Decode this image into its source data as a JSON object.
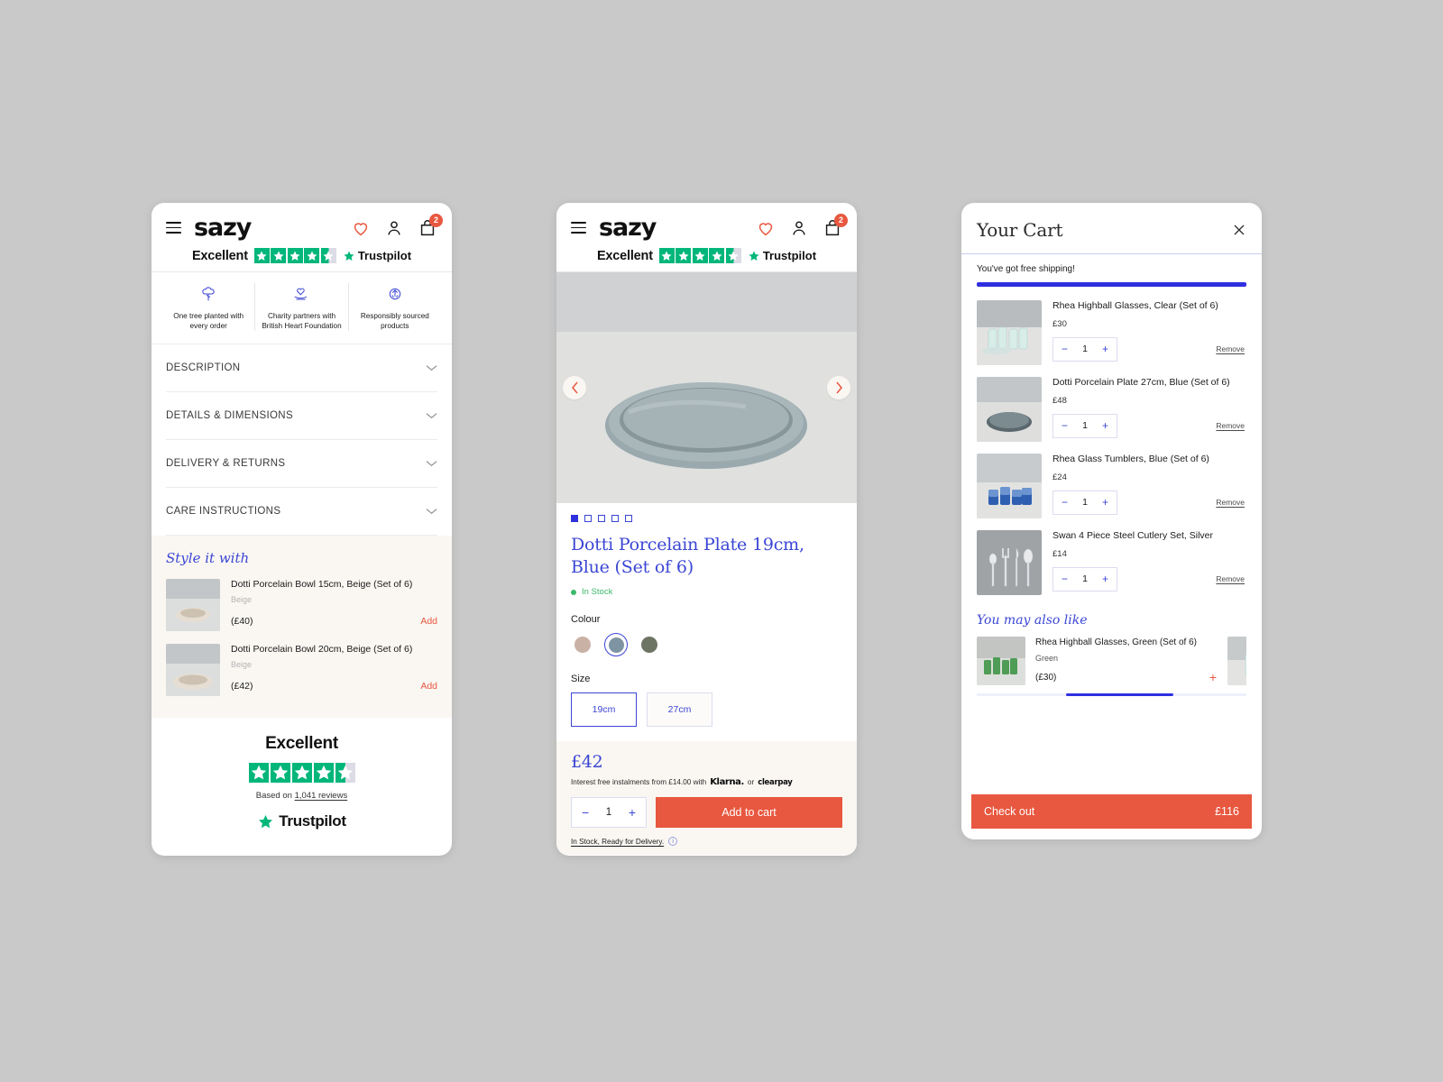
{
  "brand": "sazy",
  "header": {
    "menu_icon": "hamburger-icon",
    "wishlist_icon": "heart-icon",
    "account_icon": "user-icon",
    "cart_icon": "bag-icon",
    "cart_count": "2"
  },
  "trustpilot": {
    "rating_word": "Excellent",
    "name": "Trustpilot",
    "stars_full": 4,
    "stars_half": true,
    "footer_title": "Excellent",
    "based_on_prefix": "Based on ",
    "review_count": "1,041 reviews"
  },
  "usps": [
    {
      "icon": "tree-icon",
      "text": "One tree planted with every order"
    },
    {
      "icon": "heart-hand-icon",
      "text": "Charity partners with British Heart Foundation"
    },
    {
      "icon": "globe-recycle-icon",
      "text": "Responsibly sourced products"
    }
  ],
  "accordions": [
    {
      "label": "DESCRIPTION"
    },
    {
      "label": "DETAILS & DIMENSIONS"
    },
    {
      "label": "DELIVERY & RETURNS"
    },
    {
      "label": "CARE INSTRUCTIONS"
    }
  ],
  "style_it_with": {
    "title": "Style it with",
    "items": [
      {
        "name": "Dotti Porcelain Bowl 15cm, Beige (Set of 6)",
        "variant": "Beige",
        "price": "(£40)",
        "add_label": "Add"
      },
      {
        "name": "Dotti Porcelain Bowl 20cm, Beige (Set of 6)",
        "variant": "Beige",
        "price": "(£42)",
        "add_label": "Add"
      }
    ]
  },
  "pdp": {
    "prev_label": "‹",
    "next_label": "›",
    "dots": 5,
    "active_dot": 0,
    "title": "Dotti Porcelain Plate 19cm, Blue (Set of 6)",
    "stock_label": "In Stock",
    "colour_label": "Colour",
    "colours": [
      {
        "name": "beige",
        "hex": "#c9b2a5",
        "selected": false
      },
      {
        "name": "blue",
        "hex": "#7e94a3",
        "selected": true
      },
      {
        "name": "green",
        "hex": "#6e7463",
        "selected": false
      }
    ],
    "size_label": "Size",
    "sizes": [
      {
        "label": "19cm",
        "selected": true
      },
      {
        "label": "27cm",
        "selected": false
      }
    ],
    "price": "£42",
    "finance_text": "Interest free instalments from £14.00 with",
    "klarna_label": "Klarna.",
    "finance_or": "or",
    "clearpay_label": "clearpay",
    "qty_minus": "−",
    "qty_value": "1",
    "qty_plus": "+",
    "add_to_cart_label": "Add to cart",
    "delivery_note": "In Stock, Ready for Delivery.",
    "info_icon": "info-icon"
  },
  "cart": {
    "title": "Your Cart",
    "close_icon": "close-icon",
    "shipping_message": "You've got free shipping!",
    "shipping_progress": 100,
    "items": [
      {
        "name": "Rhea Highball Glasses, Clear (Set of 6)",
        "price": "£30",
        "qty": "1",
        "minus": "−",
        "plus": "+",
        "remove_label": "Remove",
        "thumb": "clear-glasses"
      },
      {
        "name": "Dotti Porcelain Plate 27cm, Blue (Set of 6)",
        "price": "£48",
        "qty": "1",
        "minus": "−",
        "plus": "+",
        "remove_label": "Remove",
        "thumb": "blue-plate"
      },
      {
        "name": "Rhea Glass Tumblers, Blue (Set of 6)",
        "price": "£24",
        "qty": "1",
        "minus": "−",
        "plus": "+",
        "remove_label": "Remove",
        "thumb": "blue-tumblers"
      },
      {
        "name": "Swan 4 Piece Steel Cutlery Set, Silver",
        "price": "£14",
        "qty": "1",
        "minus": "−",
        "plus": "+",
        "remove_label": "Remove",
        "thumb": "cutlery"
      }
    ],
    "also_like": {
      "title": "You may also like",
      "items": [
        {
          "name": "Rhea Highball Glasses, Green (Set of 6)",
          "variant": "Green",
          "price": "(£30)",
          "add": "+",
          "thumb": "green-glasses"
        }
      ]
    },
    "checkout_label": "Check out",
    "checkout_total": "£116"
  },
  "colors": {
    "accent_orange": "#e8573f",
    "brand_blue": "#3b46d4",
    "trust_green": "#00b67a",
    "stock_green": "#3cb96b"
  }
}
